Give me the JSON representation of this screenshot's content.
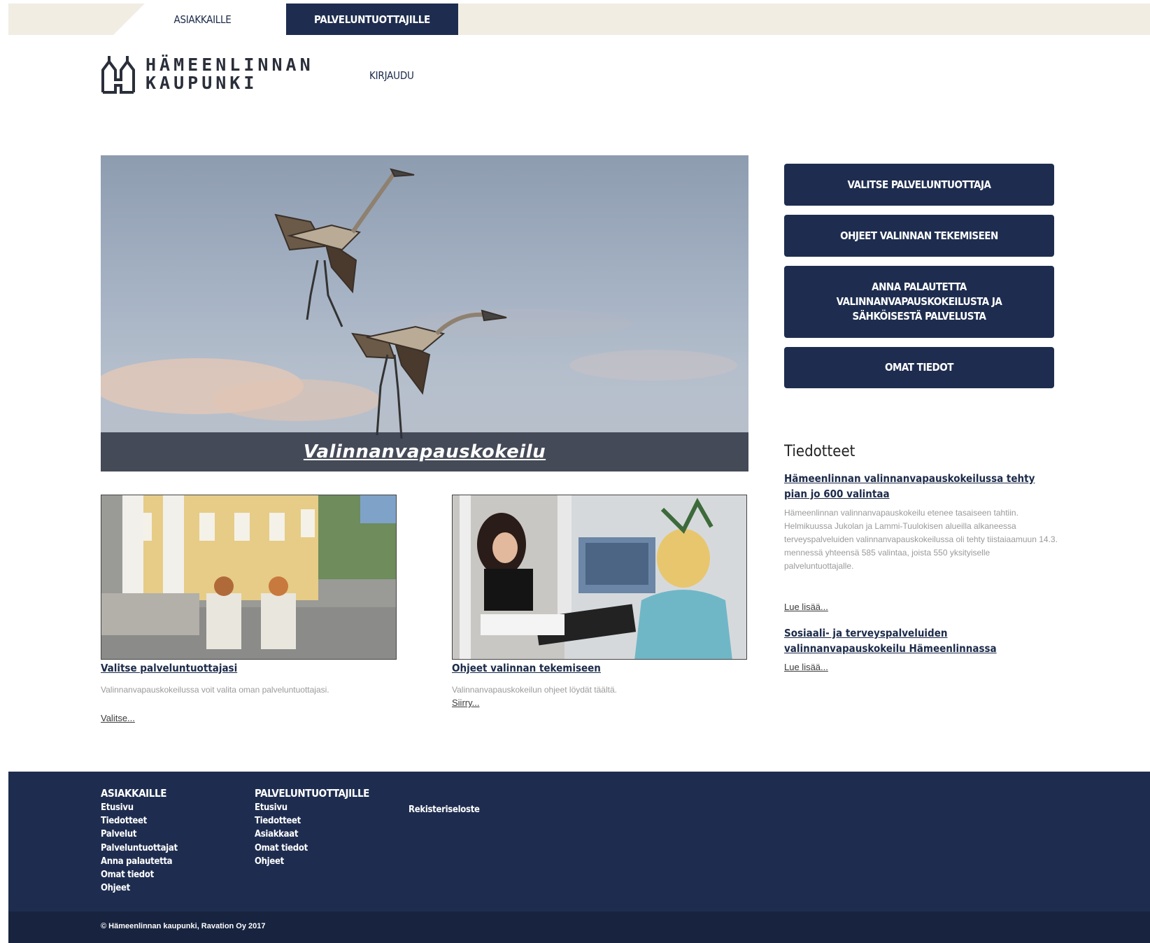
{
  "topnav": {
    "customers_tab": "ASIAKKAILLE",
    "providers_tab": "PALVELUNTUOTTAJILLE"
  },
  "header": {
    "logo_line1": "HÄMEENLINNAN",
    "logo_line2": "KAUPUNKI",
    "login": "KIRJAUDU"
  },
  "hero": {
    "caption": "Valinnanvapauskokeilu"
  },
  "sidebar_buttons": [
    {
      "label": "VALITSE PALVELUNTUOTTAJA"
    },
    {
      "label": "OHJEET VALINNAN TEKEMISEEN"
    },
    {
      "label": "ANNA PALAUTETTA VALINNANVAPAUSKOKEILUSTA JA SÄHKÖISESTÄ PALVELUSTA"
    },
    {
      "label": "OMAT TIEDOT"
    }
  ],
  "news": {
    "title": "Tiedotteet",
    "items": [
      {
        "headline": "Hämeenlinnan valinnanvapauskokeilussa tehty pian jo 600 valintaa",
        "summary": "Hämeenlinnan valinnanvapauskokeilu etenee tasaiseen tahtiin. Helmikuussa Jukolan ja Lammi-Tuulokisen alueilla alkaneessa terveyspalveluiden valinnanvapauskokeilussa oli tehty tiistaiaamuun 14.3. mennessä yhteensä 585 valintaa, joista 550 yksityiselle palveluntuottajalle.",
        "more": "Lue lisää..."
      },
      {
        "headline": "Sosiaali- ja terveyspalveluiden valinnanvapauskokeilu Hämeenlinnassa",
        "more": "Lue lisää..."
      }
    ]
  },
  "cards": [
    {
      "title": "Valitse palveluntuottajasi",
      "text": "Valinnanvapauskokeilussa voit valita oman palveluntuottajasi.",
      "link": "Valitse..."
    },
    {
      "title": "Ohjeet valinnan tekemiseen",
      "text": "Valinnanvapauskokeilun ohjeet löydät täältä.",
      "link": "Siirry..."
    }
  ],
  "footer": {
    "col1": {
      "heading": "ASIAKKAILLE",
      "links": [
        "Etusivu",
        "Tiedotteet",
        "Palvelut",
        "Palveluntuottajat",
        "Anna palautetta",
        "Omat tiedot",
        "Ohjeet"
      ]
    },
    "col2": {
      "heading": "PALVELUNTUOTTAJILLE",
      "links": [
        "Etusivu",
        "Tiedotteet",
        "Asiakkaat",
        "Omat tiedot",
        "Ohjeet"
      ]
    },
    "col3": {
      "links": [
        "Rekisteriseloste"
      ]
    },
    "copyright": "© Hämeenlinnan kaupunki, Ravation Oy 2017"
  },
  "colors": {
    "navy": "#1e2d4f",
    "topbar": "#f1ede3",
    "footer_bottom": "#18243f"
  }
}
